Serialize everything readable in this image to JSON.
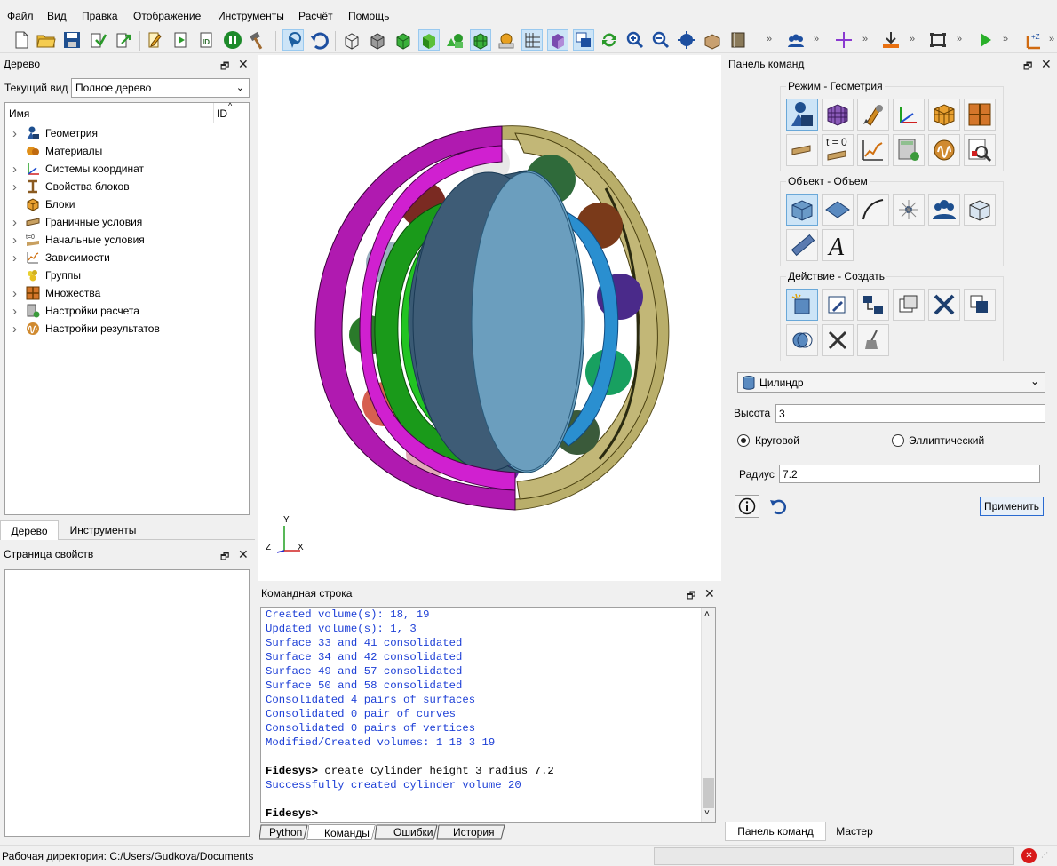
{
  "menu": [
    "Файл",
    "Вид",
    "Правка",
    "Отображение",
    "Инструменты",
    "Расчёт",
    "Помощь"
  ],
  "tree_panel": {
    "title": "Дерево",
    "current_view_label": "Текущий вид",
    "current_view_value": "Полное дерево",
    "col_name": "Имя",
    "col_id": "ID",
    "items": [
      {
        "label": "Геометрия",
        "expandable": true,
        "icon": "geometry-icon"
      },
      {
        "label": "Материалы",
        "expandable": false,
        "icon": "materials-icon"
      },
      {
        "label": "Системы координат",
        "expandable": true,
        "icon": "coordinate-systems-icon"
      },
      {
        "label": "Свойства блоков",
        "expandable": true,
        "icon": "block-properties-icon"
      },
      {
        "label": "Блоки",
        "expandable": false,
        "icon": "blocks-icon"
      },
      {
        "label": "Граничные условия",
        "expandable": true,
        "icon": "boundary-conditions-icon"
      },
      {
        "label": "Начальные условия",
        "expandable": true,
        "icon": "initial-conditions-icon"
      },
      {
        "label": "Зависимости",
        "expandable": true,
        "icon": "dependencies-icon"
      },
      {
        "label": "Группы",
        "expandable": false,
        "icon": "groups-icon"
      },
      {
        "label": "Множества",
        "expandable": true,
        "icon": "sets-icon"
      },
      {
        "label": "Настройки расчета",
        "expandable": true,
        "icon": "calc-settings-icon"
      },
      {
        "label": "Настройки результатов",
        "expandable": true,
        "icon": "result-settings-icon"
      }
    ],
    "tabs": [
      "Дерево",
      "Инструменты"
    ]
  },
  "props_panel": {
    "title": "Страница свойств"
  },
  "command_line": {
    "title": "Командная строка",
    "lines": [
      {
        "text": "Created volume(s): 18, 19",
        "kind": "out"
      },
      {
        "text": "Updated volume(s): 1, 3",
        "kind": "out"
      },
      {
        "text": "Surface 33 and 41 consolidated",
        "kind": "out"
      },
      {
        "text": "Surface 34 and 42 consolidated",
        "kind": "out"
      },
      {
        "text": "Surface 49 and 57 consolidated",
        "kind": "out"
      },
      {
        "text": "Surface 50 and 58 consolidated",
        "kind": "out"
      },
      {
        "text": "Consolidated 4 pairs of surfaces",
        "kind": "out"
      },
      {
        "text": "Consolidated 0 pair of curves",
        "kind": "out"
      },
      {
        "text": "Consolidated 0 pairs of vertices",
        "kind": "out"
      },
      {
        "text": "Modified/Created volumes: 1 18 3 19",
        "kind": "out"
      },
      {
        "text": "",
        "kind": "out"
      },
      {
        "prompt": "Fidesys>",
        "text": " create Cylinder height 3 radius 7.2",
        "kind": "cmd"
      },
      {
        "text": "Successfully created cylinder volume 20",
        "kind": "out"
      },
      {
        "text": "",
        "kind": "out"
      },
      {
        "prompt": "Fidesys>",
        "text": "",
        "kind": "cmd"
      }
    ],
    "tabs": [
      "Python",
      "Команды",
      "Ошибки",
      "История"
    ]
  },
  "command_panel": {
    "title": "Панель команд",
    "mode_title": "Режим - Геометрия",
    "object_title": "Объект - Объем",
    "action_title": "Действие - Создать",
    "t0_label": "t = 0",
    "shape_value": "Цилиндр",
    "height_label": "Высота",
    "height_value": "3",
    "radio_circular": "Круговой",
    "radio_elliptic": "Эллиптический",
    "radius_label": "Радиус",
    "radius_value": "7.2",
    "apply_label": "Применить",
    "tabs": [
      "Панель команд",
      "Мастер"
    ]
  },
  "axis_labels": {
    "y": "Y",
    "x": "X",
    "z": "Z"
  },
  "status": {
    "workdir": "Рабочая директория: C:/Users/Gudkova/Documents"
  }
}
